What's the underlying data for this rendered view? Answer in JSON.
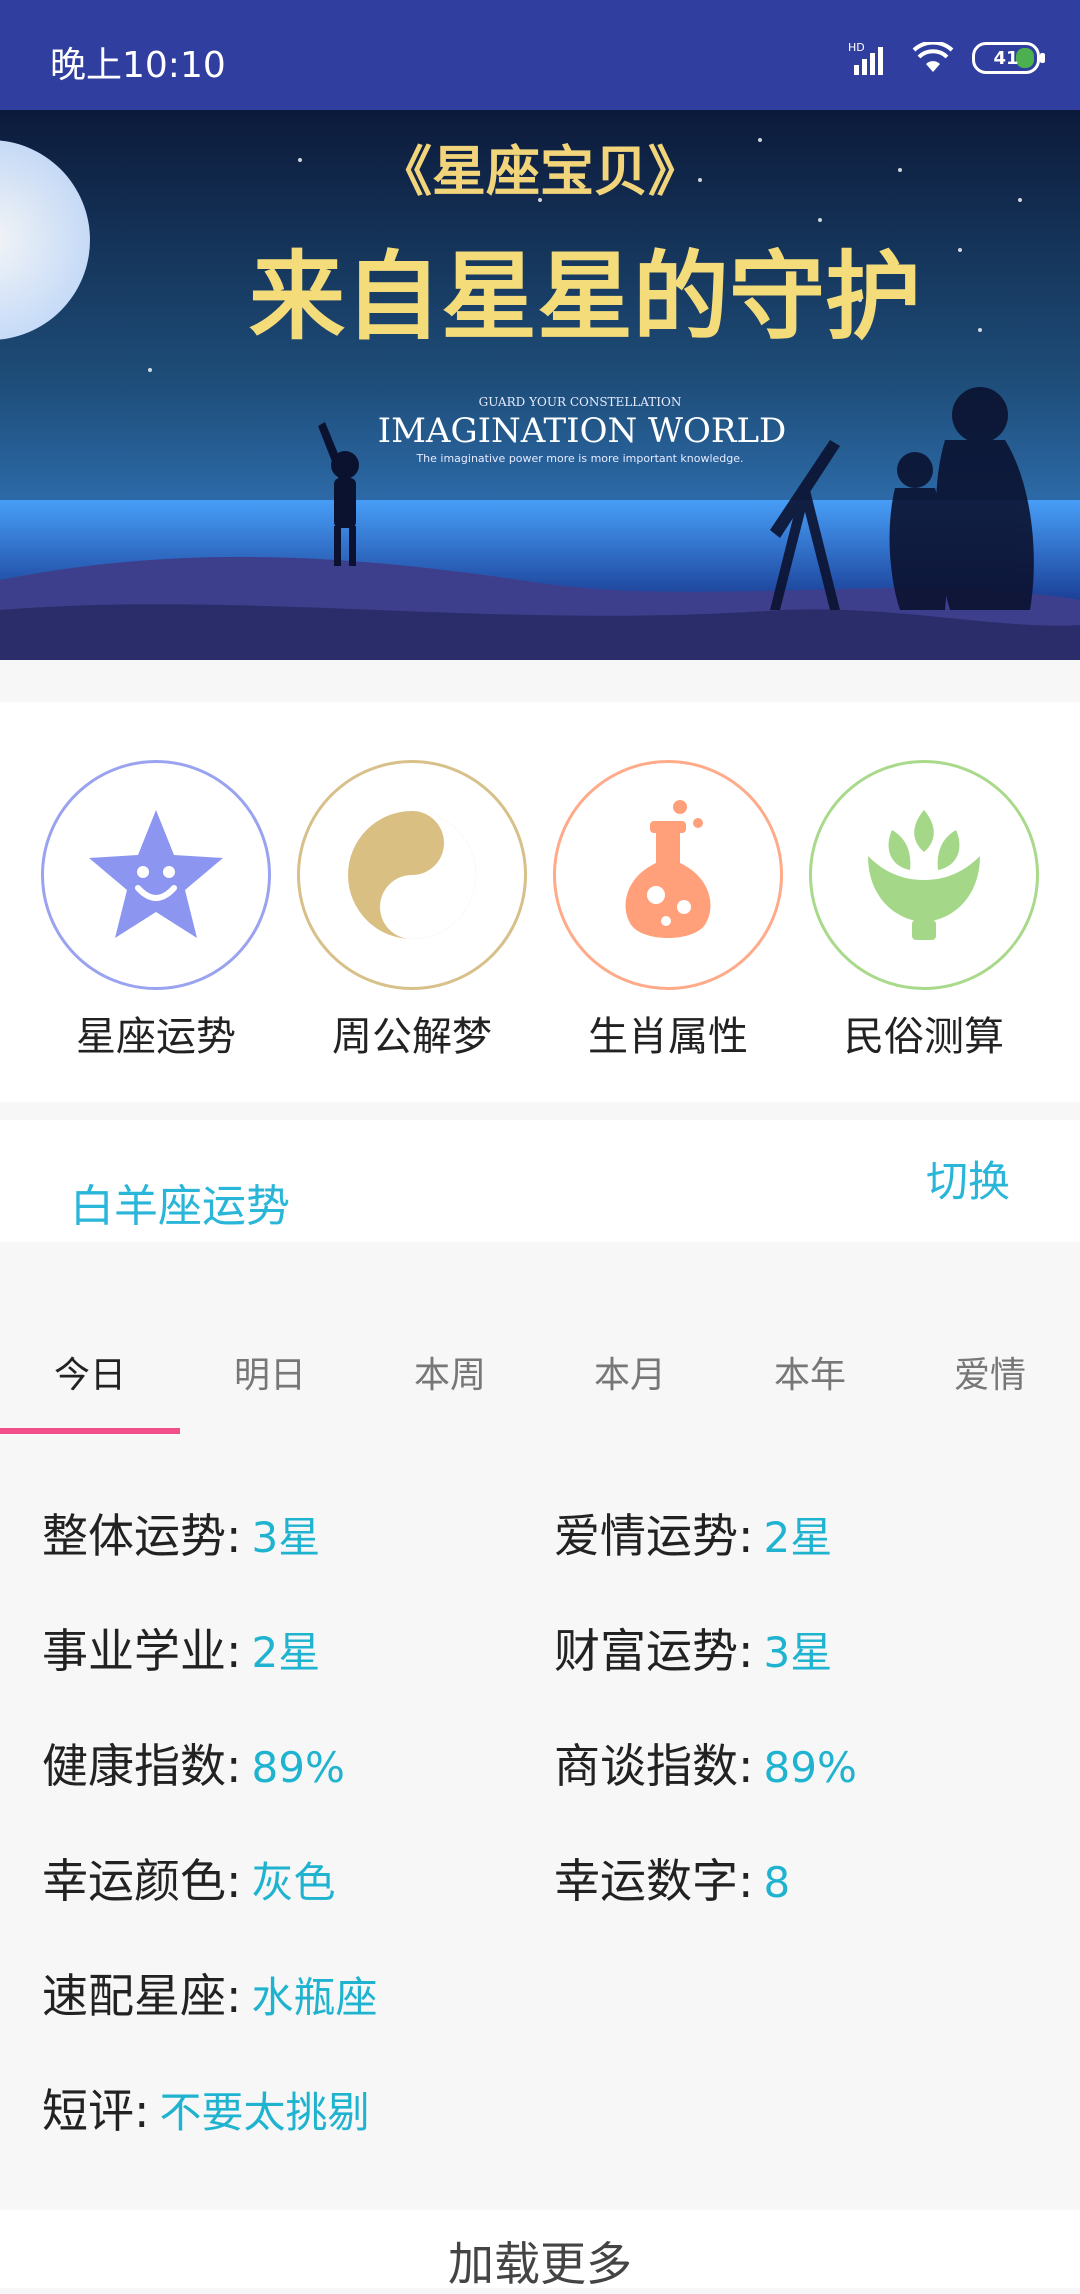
{
  "status_bar": {
    "time": "晚上10:10",
    "battery": "41",
    "network": "HD"
  },
  "banner": {
    "title_line1": "《星座宝贝》",
    "title_line2": "来自星星的守护",
    "en_small": "GUARD YOUR CONSTELLATION",
    "en_title": "IMAGINATION WORLD",
    "en_sub": "The imaginative power more is more important knowledge."
  },
  "categories": [
    {
      "label": "星座运势",
      "color": "#9aa3ef",
      "icon": "star-smile-icon"
    },
    {
      "label": "周公解梦",
      "color": "#d8c08a",
      "icon": "yin-yang-icon"
    },
    {
      "label": "生肖属性",
      "color": "#ffab8a",
      "icon": "flask-icon"
    },
    {
      "label": "民俗测算",
      "color": "#a9d98a",
      "icon": "artichoke-icon"
    }
  ],
  "horoscope": {
    "title": "白羊座运势",
    "switch_label": "切换"
  },
  "tabs": [
    "今日",
    "明日",
    "本周",
    "本月",
    "本年",
    "爱情"
  ],
  "active_tab": 0,
  "info": {
    "overall_label": "整体运势:",
    "overall_value": "3星",
    "love_label": "爱情运势:",
    "love_value": "2星",
    "career_label": "事业学业:",
    "career_value": "2星",
    "wealth_label": "财富运势:",
    "wealth_value": "3星",
    "health_label": "健康指数:",
    "health_value": "89%",
    "negotiation_label": "商谈指数:",
    "negotiation_value": "89%",
    "lucky_color_label": "幸运颜色:",
    "lucky_color_value": "灰色",
    "lucky_number_label": "幸运数字:",
    "lucky_number_value": "8",
    "match_label": "速配星座:",
    "match_value": "水瓶座",
    "comment_label": "短评:",
    "comment_value": "不要太挑剔"
  },
  "load_more": "加载更多",
  "colors": {
    "primary": "#303f9f",
    "accent": "#29b6d8",
    "tab_indicator": "#f04f8a"
  }
}
